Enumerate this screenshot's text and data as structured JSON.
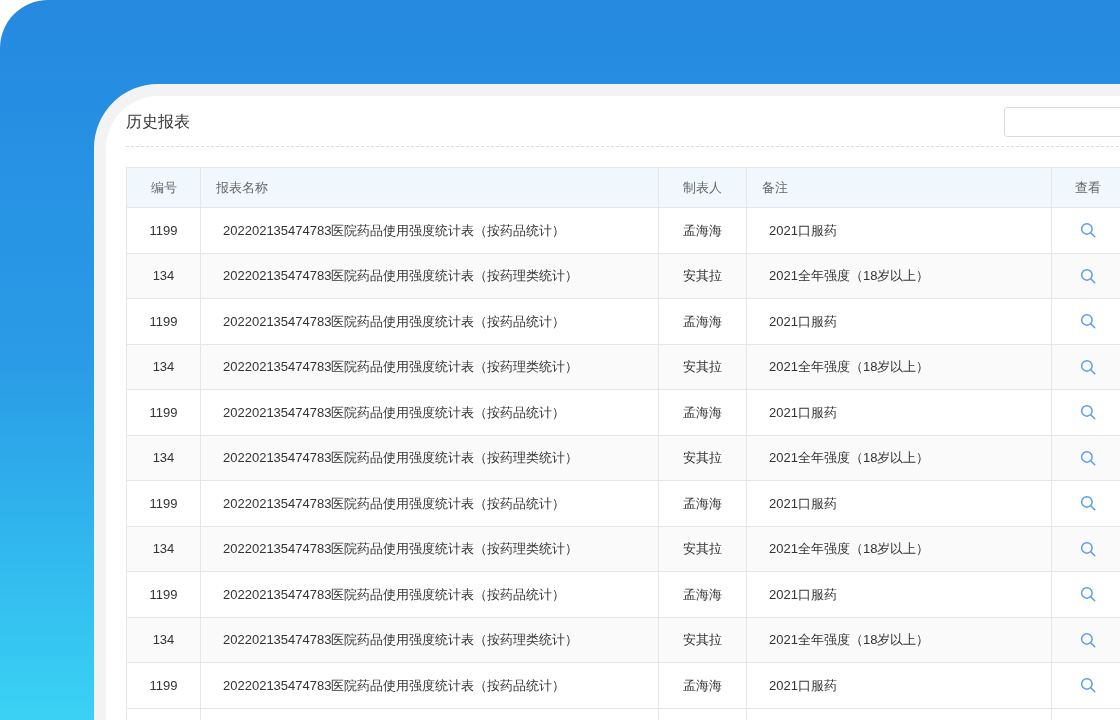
{
  "page": {
    "title": "历史报表"
  },
  "table": {
    "columns": [
      "编号",
      "报表名称",
      "制表人",
      "备注",
      "查看"
    ],
    "rows": [
      {
        "id": "1199",
        "name": "202202135474783医院药品使用强度统计表（按药品统计）",
        "author": "孟海海",
        "note": "2021口服药"
      },
      {
        "id": "134",
        "name": "202202135474783医院药品使用强度统计表（按药理类统计）",
        "author": "安其拉",
        "note": "2021全年强度（18岁以上）"
      },
      {
        "id": "1199",
        "name": "202202135474783医院药品使用强度统计表（按药品统计）",
        "author": "孟海海",
        "note": "2021口服药"
      },
      {
        "id": "134",
        "name": "202202135474783医院药品使用强度统计表（按药理类统计）",
        "author": "安其拉",
        "note": "2021全年强度（18岁以上）"
      },
      {
        "id": "1199",
        "name": "202202135474783医院药品使用强度统计表（按药品统计）",
        "author": "孟海海",
        "note": "2021口服药"
      },
      {
        "id": "134",
        "name": "202202135474783医院药品使用强度统计表（按药理类统计）",
        "author": "安其拉",
        "note": "2021全年强度（18岁以上）"
      },
      {
        "id": "1199",
        "name": "202202135474783医院药品使用强度统计表（按药品统计）",
        "author": "孟海海",
        "note": "2021口服药"
      },
      {
        "id": "134",
        "name": "202202135474783医院药品使用强度统计表（按药理类统计）",
        "author": "安其拉",
        "note": "2021全年强度（18岁以上）"
      },
      {
        "id": "1199",
        "name": "202202135474783医院药品使用强度统计表（按药品统计）",
        "author": "孟海海",
        "note": "2021口服药"
      },
      {
        "id": "134",
        "name": "202202135474783医院药品使用强度统计表（按药理类统计）",
        "author": "安其拉",
        "note": "2021全年强度（18岁以上）"
      },
      {
        "id": "1199",
        "name": "202202135474783医院药品使用强度统计表（按药品统计）",
        "author": "孟海海",
        "note": "2021口服药"
      }
    ]
  }
}
